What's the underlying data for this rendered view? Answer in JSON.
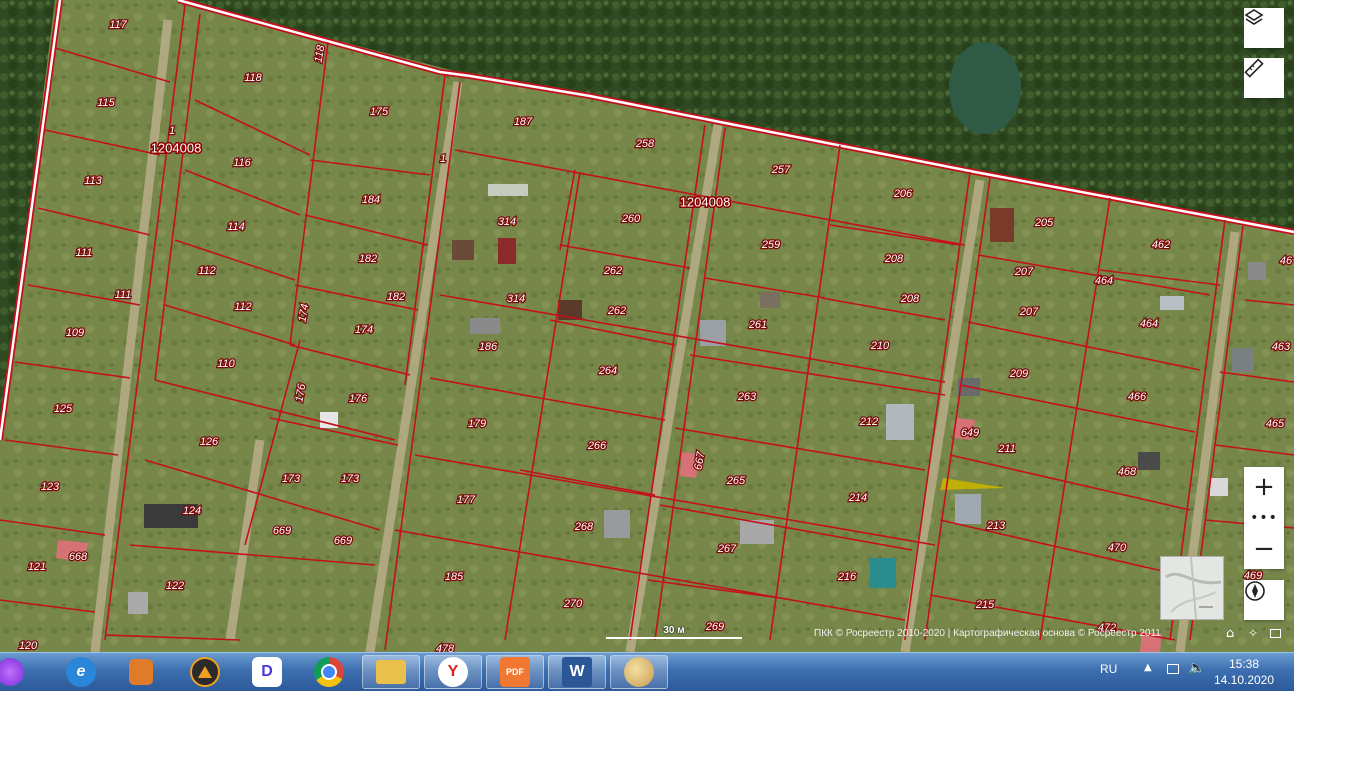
{
  "map": {
    "block_labels": [
      "1204008",
      "1204008"
    ],
    "plot_labels": [
      "117",
      "118",
      "118",
      "175",
      "115",
      "1",
      "116",
      "187",
      "258",
      "1",
      "257",
      "206",
      "113",
      "184",
      "314",
      "260",
      "205",
      "462",
      "114",
      "259",
      "111",
      "112",
      "182",
      "208",
      "182",
      "262",
      "207",
      "464",
      "46",
      "111",
      "112",
      "174",
      "314",
      "262",
      "208",
      "207",
      "464",
      "109",
      "174",
      "261",
      "110",
      "186",
      "210",
      "463",
      "264",
      "209",
      "125",
      "176",
      "263",
      "466",
      "212",
      "179",
      "465",
      "176",
      "649",
      "126",
      "211",
      "266",
      "667",
      "468",
      "265",
      "173",
      "173",
      "177",
      "214",
      "123",
      "124",
      "213",
      "669",
      "669",
      "268",
      "470",
      "668",
      "267",
      "121",
      "122",
      "185",
      "216",
      "215",
      "469",
      "270",
      "472",
      "269",
      "120",
      "478"
    ],
    "scale": {
      "label": "30 м"
    },
    "attribution": "ПКК © Росреестр 2010-2020 | Картографическая основа © Росреестр 2011",
    "controls": {
      "layers_icon": "layers-icon",
      "ruler_icon": "ruler-icon",
      "zoom_in": "+",
      "more": "•••",
      "zoom_out": "−",
      "compass_icon": "compass-icon"
    },
    "colors": {
      "boundary": "#c4101c",
      "road": "#ffffff",
      "highlight": "#c8b400"
    }
  },
  "taskbar": {
    "apps": [
      {
        "name": "start-orb",
        "label": ""
      },
      {
        "name": "internet-explorer",
        "label": "e"
      },
      {
        "name": "media-player",
        "label": ""
      },
      {
        "name": "aimp",
        "label": ""
      },
      {
        "name": "player",
        "label": "D"
      },
      {
        "name": "chrome",
        "label": ""
      },
      {
        "name": "file-explorer",
        "label": ""
      },
      {
        "name": "yandex-browser",
        "label": "Y"
      },
      {
        "name": "pdf-app",
        "label": "PDF"
      },
      {
        "name": "word",
        "label": "W"
      },
      {
        "name": "paint",
        "label": ""
      }
    ],
    "tray": {
      "language": "RU",
      "time": "15:38",
      "date": "14.10.2020"
    }
  }
}
